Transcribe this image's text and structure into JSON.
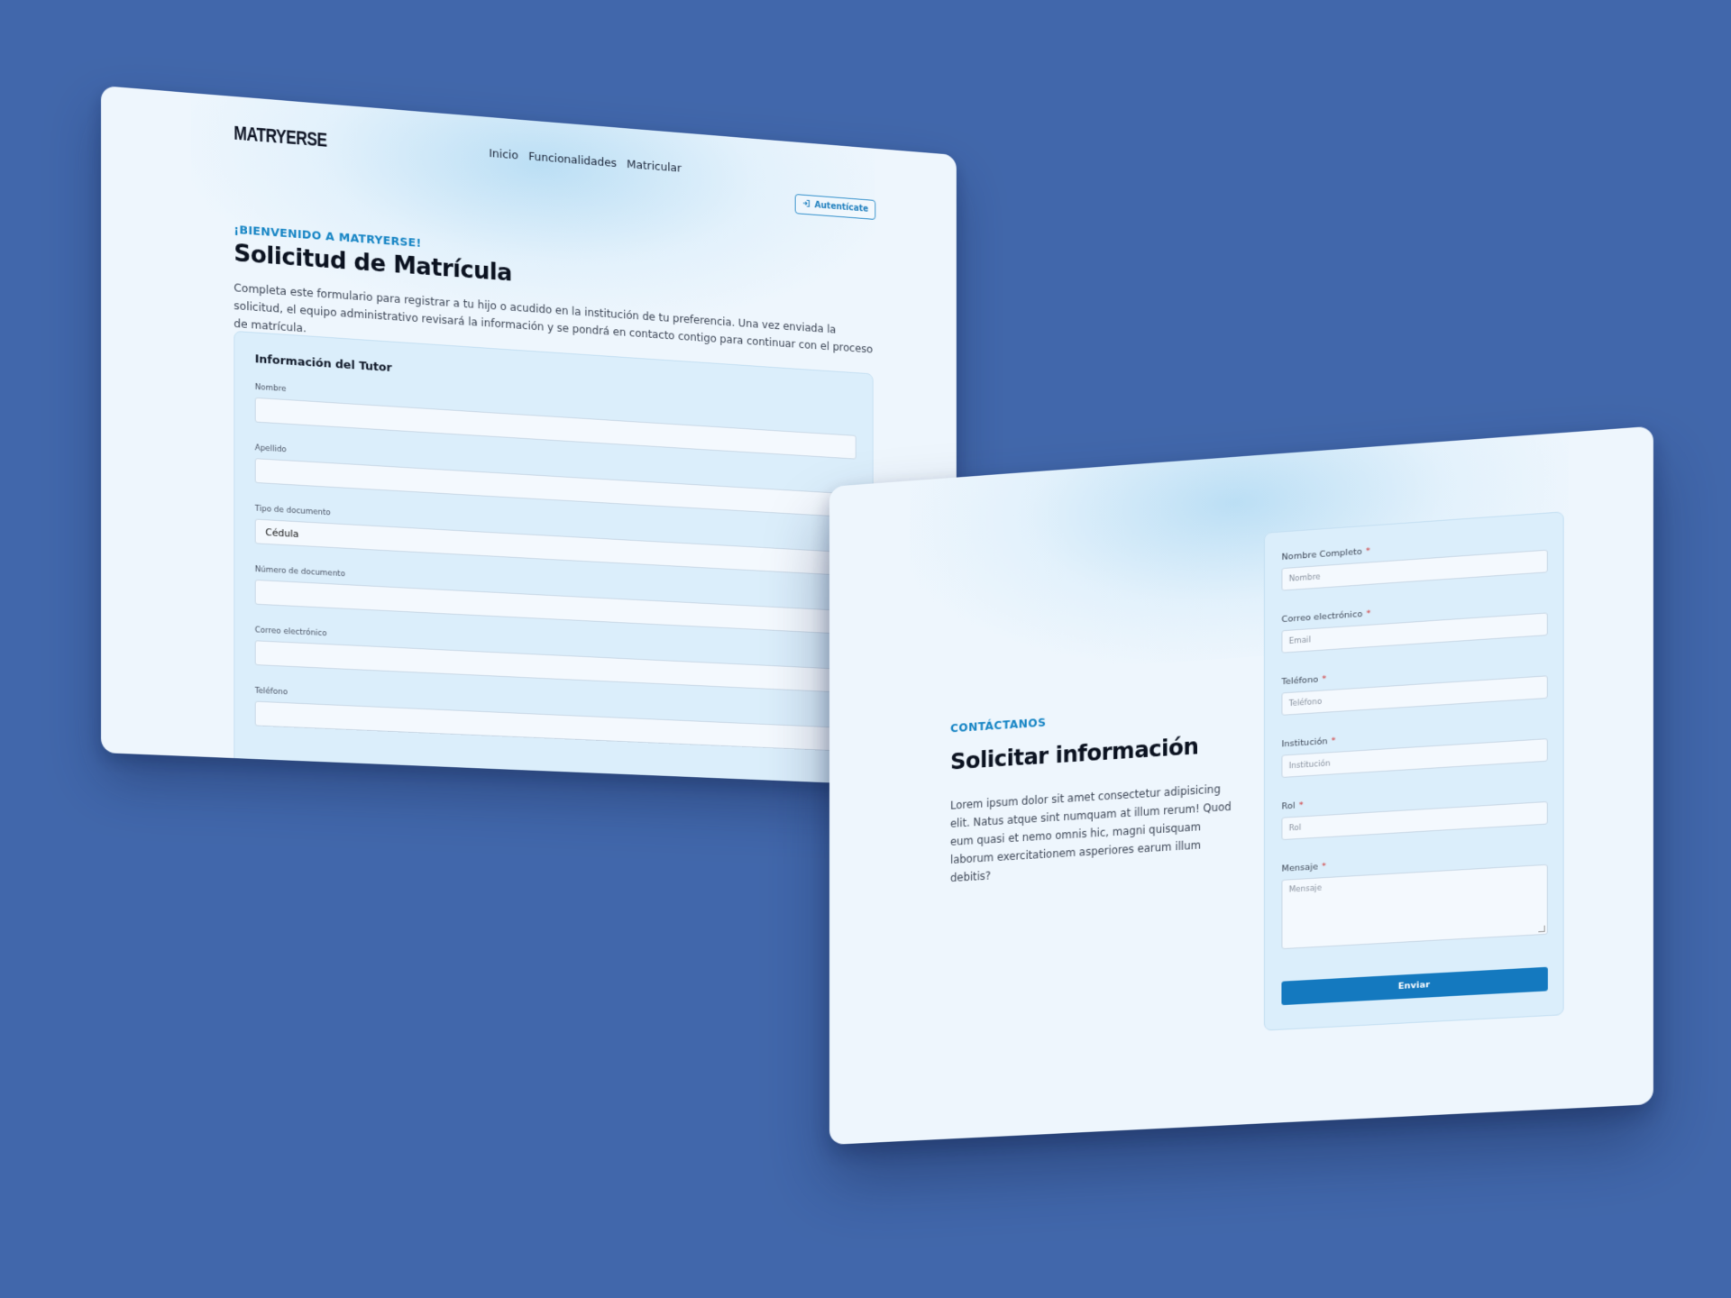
{
  "enrollment_page": {
    "logo": "MATRYERSE",
    "nav": [
      "Inicio",
      "Funcionalidades",
      "Matricular"
    ],
    "login_label": "Autentícate",
    "eyebrow": "¡BIENVENIDO A MATRYERSE!",
    "title": "Solicitud de Matrícula",
    "description": "Completa este formulario para registrar a tu hijo o acudido en la institución de tu preferencia. Una vez enviada la solicitud, el equipo administrativo revisará la información y se pondrá en contacto contigo para continuar con el proceso de matrícula.",
    "form": {
      "section_title": "Información del Tutor",
      "fields": [
        {
          "label": "Nombre",
          "value": ""
        },
        {
          "label": "Apellido",
          "value": ""
        },
        {
          "label": "Tipo de documento",
          "value": "Cédula"
        },
        {
          "label": "Número de documento",
          "value": ""
        },
        {
          "label": "Correo electrónico",
          "value": ""
        },
        {
          "label": "Teléfono",
          "value": ""
        }
      ]
    }
  },
  "contact_page": {
    "eyebrow": "CONTÁCTANOS",
    "title": "Solicitar información",
    "description": "Lorem ipsum dolor sit amet consectetur adipisicing elit. Natus atque sint numquam at illum rerum! Quod eum quasi et nemo omnis hic, magni quisquam laborum exercitationem asperiores earum illum debitis?",
    "required_mark": "*",
    "fields": [
      {
        "label": "Nombre Completo",
        "placeholder": "Nombre"
      },
      {
        "label": "Correo electrónico",
        "placeholder": "Email"
      },
      {
        "label": "Teléfono",
        "placeholder": "Teléfono"
      },
      {
        "label": "Institución",
        "placeholder": "Institución"
      },
      {
        "label": "Rol",
        "placeholder": "Rol"
      },
      {
        "label": "Mensaje",
        "placeholder": "Mensaje"
      }
    ],
    "submit_label": "Enviar"
  },
  "colors": {
    "background": "#4167ab",
    "accent": "#1584c4",
    "button": "#1479bf"
  }
}
